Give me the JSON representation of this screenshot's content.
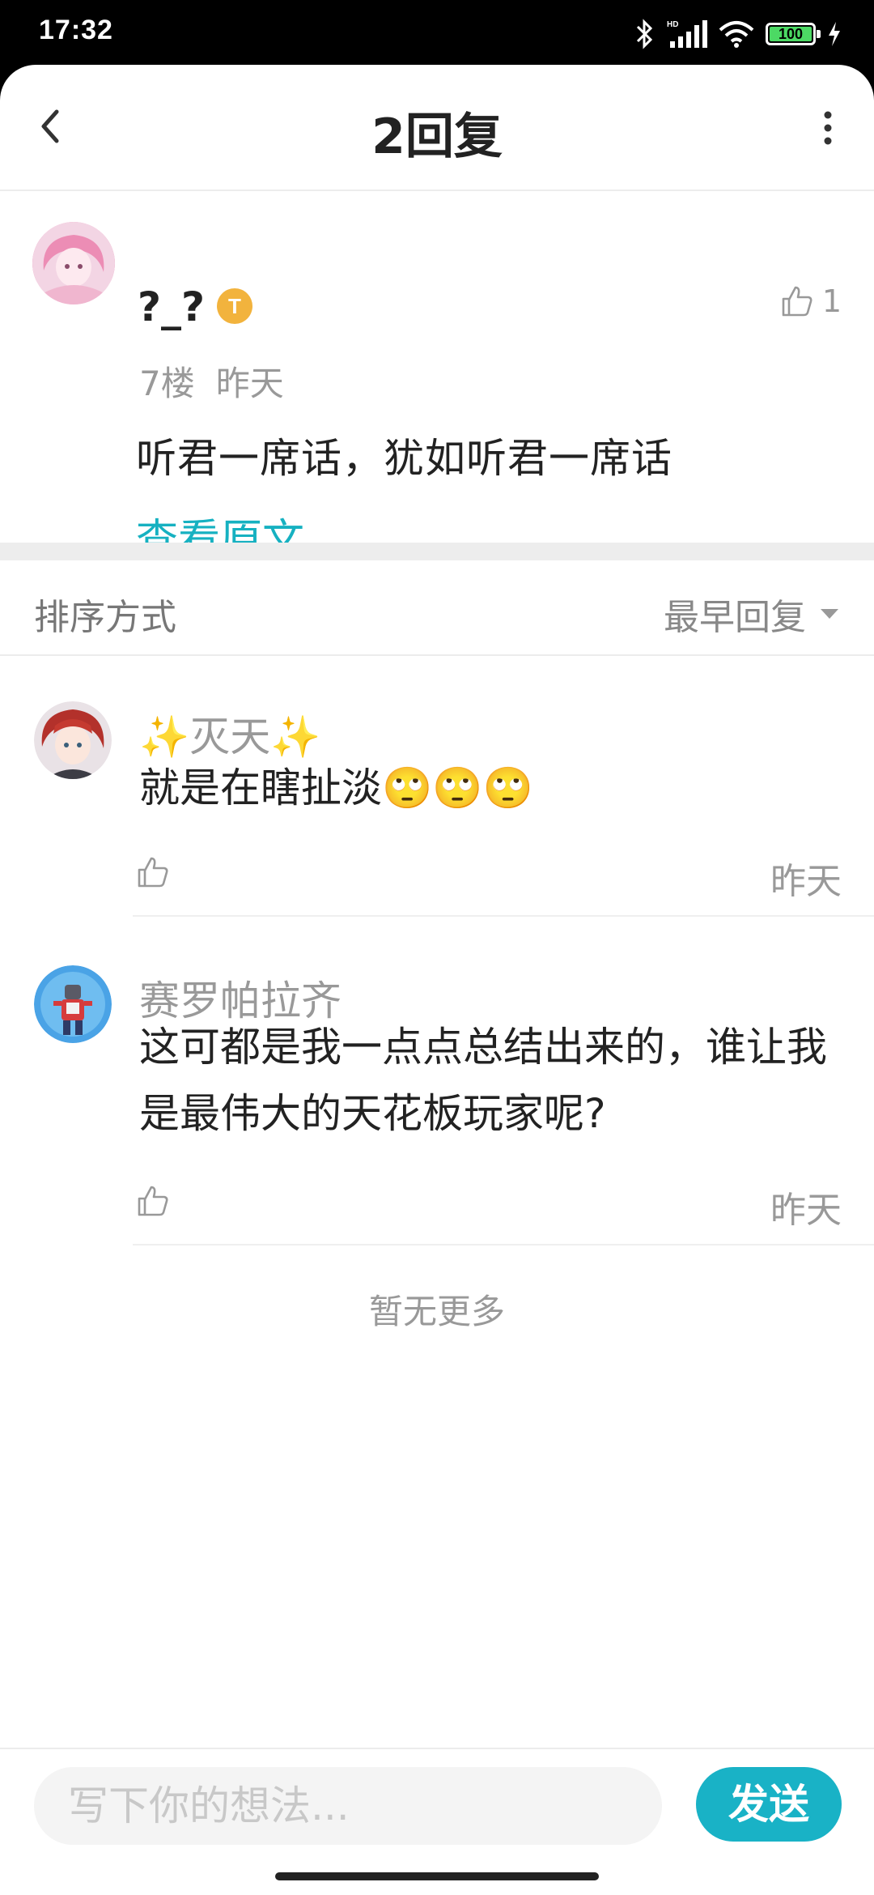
{
  "status_bar": {
    "time": "17:32",
    "battery": "100"
  },
  "header": {
    "title": "2回复",
    "back_icon": "chevron-left-icon",
    "more_icon": "vertical-dots-icon"
  },
  "main_post": {
    "username": "?_?",
    "badge": "T",
    "likes": "1",
    "floor": "7楼",
    "time": "昨天",
    "content": "听君一席话，犹如听君一席话",
    "view_original": "查看原文"
  },
  "sort": {
    "label": "排序方式",
    "selected": "最早回复"
  },
  "replies": [
    {
      "name": "✨灭天✨",
      "text": "就是在瞎扯淡🙄🙄🙄",
      "time": "昨天"
    },
    {
      "name": "赛罗帕拉齐",
      "text": "这可都是我一点点总结出来的，谁让我是最伟大的天花板玩家呢?",
      "time": "昨天"
    }
  ],
  "footer_note": "暂无更多",
  "composer": {
    "placeholder": "写下你的想法...",
    "send_label": "发送"
  },
  "colors": {
    "accent": "#19b2c6",
    "link": "#16b1c1",
    "muted": "#999999"
  }
}
